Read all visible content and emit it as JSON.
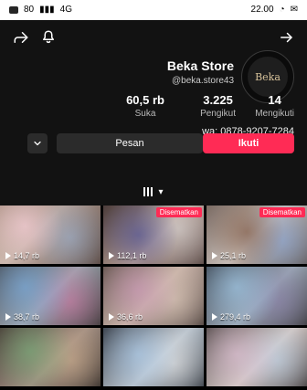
{
  "status_bar": {
    "time": "22.00",
    "signal": "4G",
    "battery": "80"
  },
  "header": {
    "back_icon": "arrow-left-icon",
    "bell_icon": "bell-icon",
    "share_icon": "share-icon"
  },
  "profile": {
    "avatar_text": "Beka",
    "name": "Beka Store",
    "handle": "@beka.store43",
    "bio": "wa: 0878-9207-7284"
  },
  "stats": [
    {
      "value": "14",
      "label": "Mengikuti"
    },
    {
      "value": "3.225",
      "label": "Pengikut"
    },
    {
      "value": "60,5 rb",
      "label": "Suka"
    }
  ],
  "actions": {
    "follow": "Ikuti",
    "message": "Pesan",
    "dropdown_icon": "chevron-down-icon"
  },
  "tabs": {
    "grid_icon": "grid-icon",
    "caret": "▾"
  },
  "grid": [
    {
      "pinned": "",
      "views": "14,7 rb"
    },
    {
      "pinned": "Disematkan",
      "views": "112,1 rb"
    },
    {
      "pinned": "Disematkan",
      "views": "25,1 rb"
    },
    {
      "pinned": "",
      "views": "38,7 rb"
    },
    {
      "pinned": "",
      "views": "36,6 rb"
    },
    {
      "pinned": "",
      "views": "279,4 rb"
    },
    {
      "pinned": "",
      "views": ""
    },
    {
      "pinned": "",
      "views": ""
    },
    {
      "pinned": "",
      "views": ""
    }
  ]
}
